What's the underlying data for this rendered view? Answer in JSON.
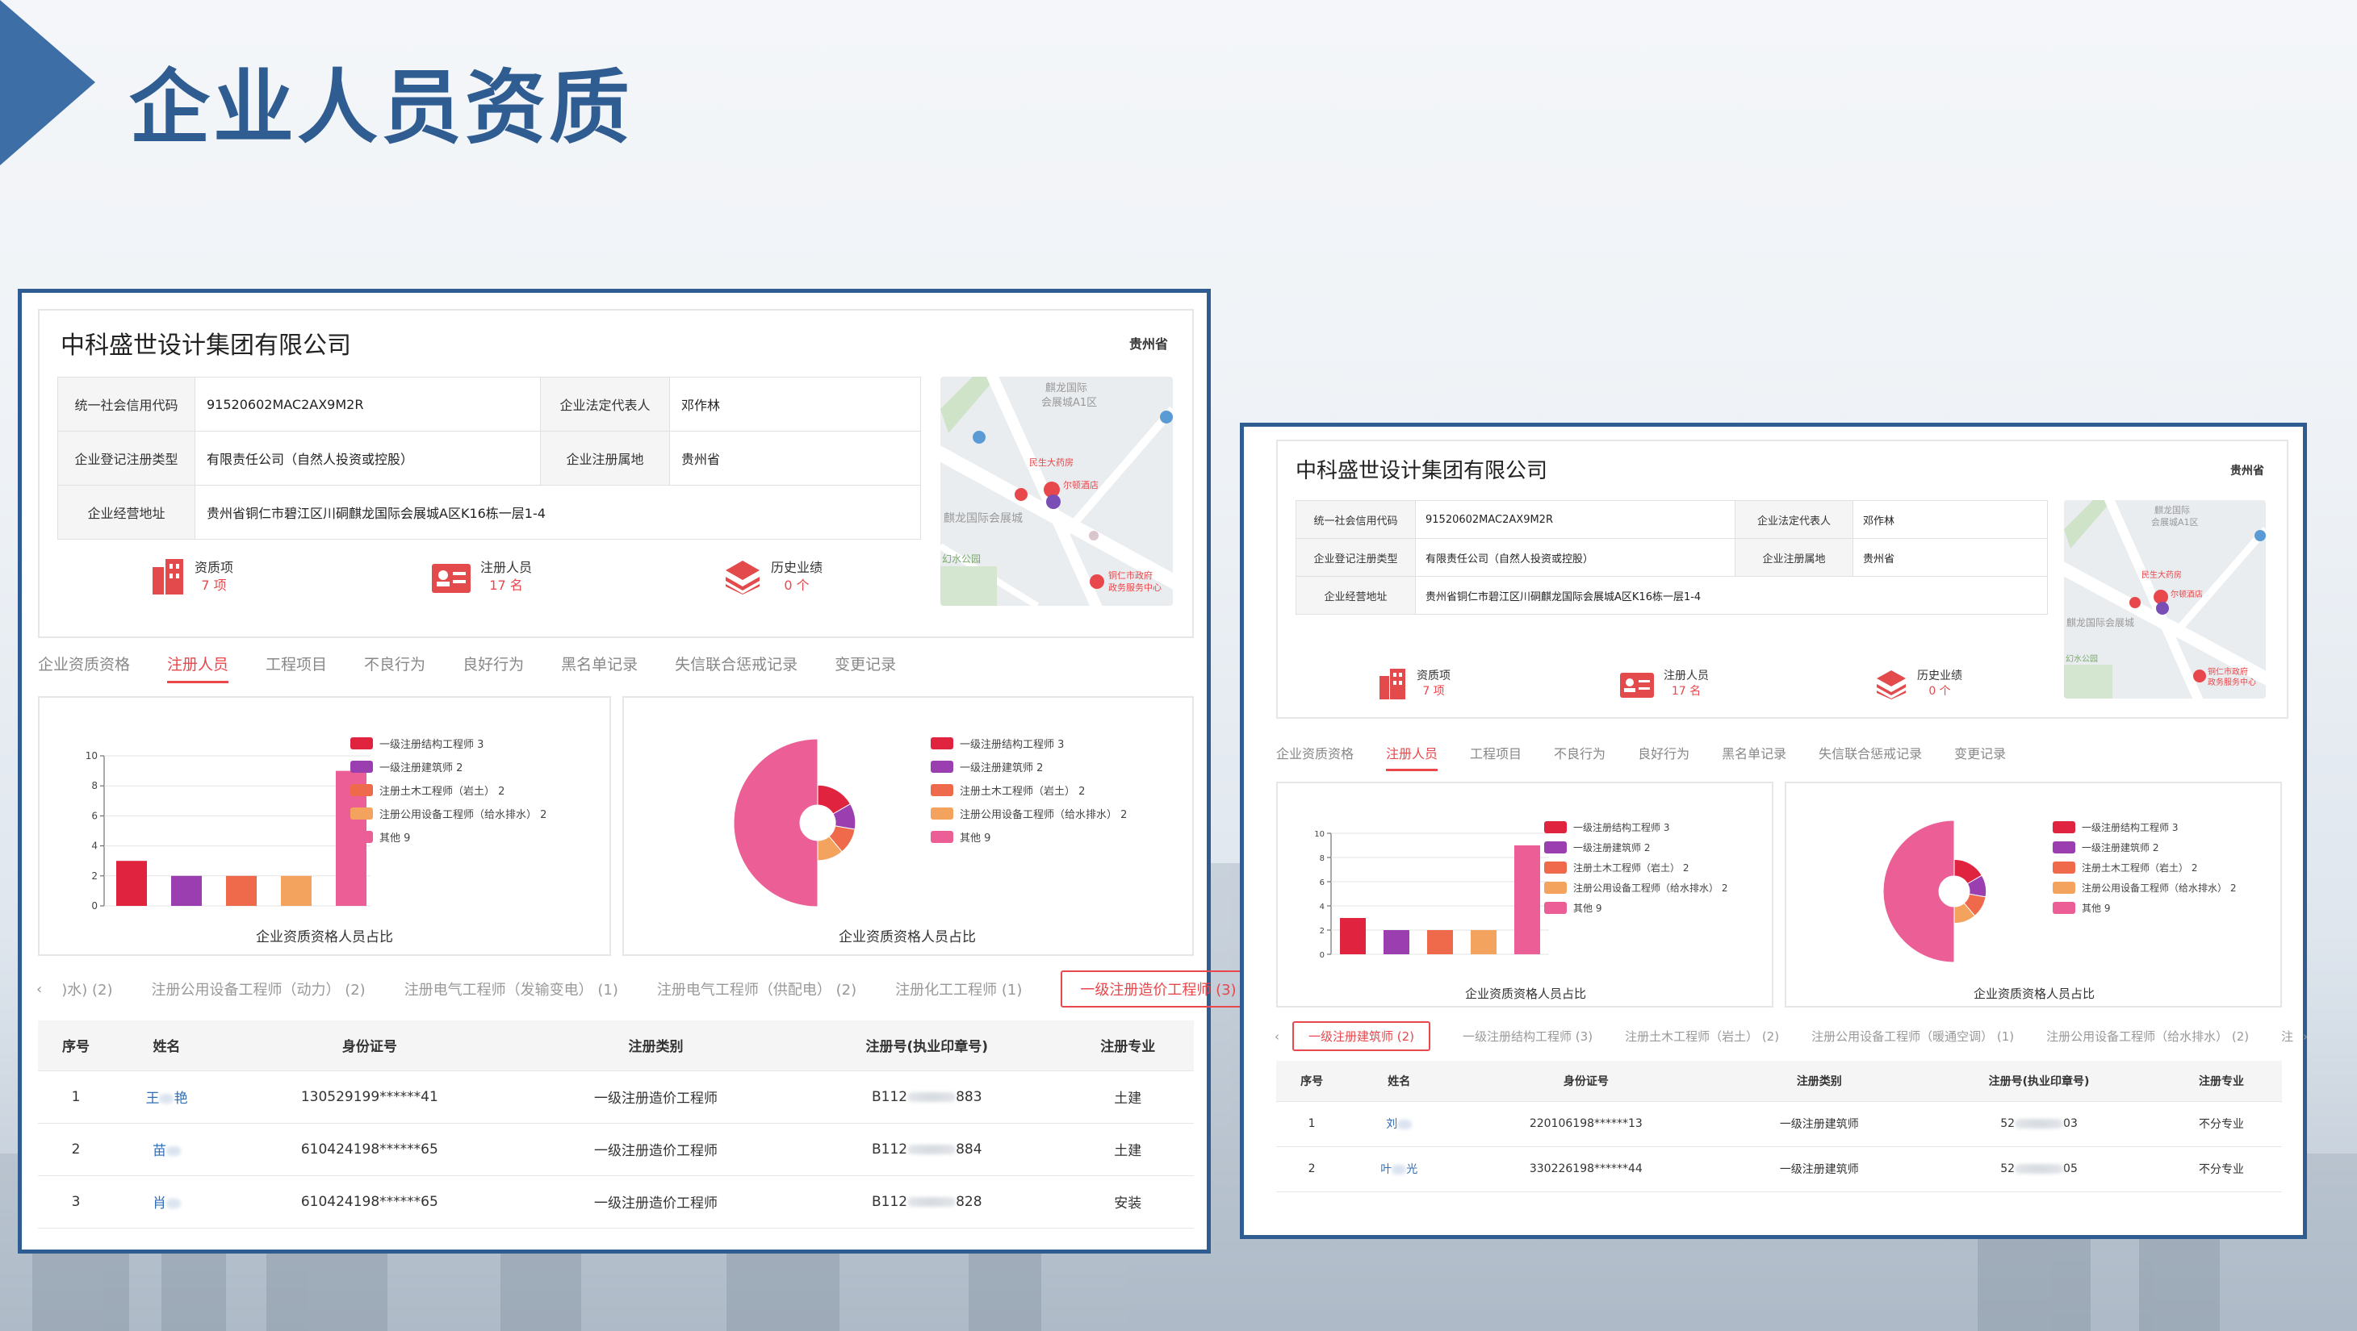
{
  "slide": {
    "title": "企业人员资质"
  },
  "company": {
    "name": "中科盛世设计集团有限公司",
    "province_badge": "贵州省",
    "info": [
      {
        "k1": "统一社会信用代码",
        "v1": "91520602MAC2AX9M2R",
        "k2": "企业法定代表人",
        "v2": "邓作林"
      },
      {
        "k1": "企业登记注册类型",
        "v1": "有限责任公司（自然人投资或控股）",
        "k2": "企业注册属地",
        "v2": "贵州省"
      },
      {
        "k1": "企业经营地址",
        "v1": "贵州省铜仁市碧江区川硐麒龙国际会展城A区K16栋一层1-4"
      }
    ],
    "map_labels": [
      "麒龙国际",
      "会展城A1区",
      "民生大药房",
      "尔顿酒店",
      "麒龙国际会展城",
      "幻水公园",
      "铜仁市政府",
      "政务服务中心"
    ],
    "stats": [
      {
        "label": "资质项",
        "value": "7 项",
        "icon": "building-icon"
      },
      {
        "label": "注册人员",
        "value": "17 名",
        "icon": "id-card-icon"
      },
      {
        "label": "历史业绩",
        "value": "0 个",
        "icon": "layers-icon"
      }
    ],
    "tabs": [
      "企业资质资格",
      "注册人员",
      "工程项目",
      "不良行为",
      "良好行为",
      "黑名单记录",
      "失信联合惩戒记录",
      "变更记录"
    ],
    "active_tab": "注册人员"
  },
  "chart_data": [
    {
      "type": "bar",
      "title": "企业资质资格人员占比",
      "categories": [
        "一级注册结构工程师",
        "一级注册建筑师",
        "注册土木工程师（岩土）",
        "注册公用设备工程师（给水排水）",
        "其他"
      ],
      "values": [
        3,
        2,
        2,
        2,
        9
      ],
      "legend": [
        "一级注册结构工程师 3",
        "一级注册建筑师 2",
        "注册土木工程师（岩土） 2",
        "注册公用设备工程师（给水排水） 2",
        "其他 9"
      ],
      "colors": [
        "#e0243f",
        "#9b3fb0",
        "#ef6a4b",
        "#f4a35f",
        "#ec5f96"
      ],
      "ylim": [
        0,
        10
      ],
      "yticks": [
        0,
        2,
        4,
        6,
        8,
        10
      ],
      "grid": true,
      "legend_position": "right"
    },
    {
      "type": "pie",
      "title": "企业资质资格人员占比",
      "categories": [
        "一级注册结构工程师",
        "一级注册建筑师",
        "注册土木工程师（岩土）",
        "注册公用设备工程师（给水排水）",
        "其他"
      ],
      "values": [
        3,
        2,
        2,
        2,
        9
      ],
      "legend": [
        "一级注册结构工程师 3",
        "一级注册建筑师 2",
        "注册土木工程师（岩土） 2",
        "注册公用设备工程师（给水排水） 2",
        "其他 9"
      ],
      "colors": [
        "#e0243f",
        "#9b3fb0",
        "#ef6a4b",
        "#f4a35f",
        "#ec5f96"
      ],
      "legend_position": "right"
    }
  ],
  "panel1": {
    "subtabs": [
      ")水)  (2)",
      "注册公用设备工程师（动力） (2)",
      "注册电气工程师（发输变电） (1)",
      "注册电气工程师（供配电） (2)",
      "注册化工工程师 (1)",
      "一级注册造价工程师 (3)"
    ],
    "active_subtab": "一级注册造价工程师 (3)",
    "headers": [
      "序号",
      "姓名",
      "身份证号",
      "注册类别",
      "注册号(执业印章号)",
      "注册专业"
    ],
    "rows": [
      {
        "no": "1",
        "name_a": "王",
        "name_b": "艳",
        "id": "130529199******41",
        "type": "一级注册造价工程师",
        "reg_a": "B112",
        "reg_b": "883",
        "major": "土建"
      },
      {
        "no": "2",
        "name_a": "苗",
        "name_b": "",
        "id": "610424198******65",
        "type": "一级注册造价工程师",
        "reg_a": "B112",
        "reg_b": "884",
        "major": "土建"
      },
      {
        "no": "3",
        "name_a": "肖",
        "name_b": "",
        "id": "610424198******65",
        "type": "一级注册造价工程师",
        "reg_a": "B112",
        "reg_b": "828",
        "major": "安装"
      }
    ]
  },
  "panel2": {
    "subtabs": [
      "一级注册建筑师 (2)",
      "一级注册结构工程师 (3)",
      "注册土木工程师（岩土） (2)",
      "注册公用设备工程师（暖通空调） (1)",
      "注册公用设备工程师（给水排水） (2)",
      "注"
    ],
    "active_subtab": "一级注册建筑师 (2)",
    "headers": [
      "序号",
      "姓名",
      "身份证号",
      "注册类别",
      "注册号(执业印章号)",
      "注册专业"
    ],
    "rows": [
      {
        "no": "1",
        "name_a": "刘",
        "name_b": "",
        "id": "220106198******13",
        "type": "一级注册建筑师",
        "reg_a": "52",
        "reg_b": "03",
        "major": "不分专业"
      },
      {
        "no": "2",
        "name_a": "叶",
        "name_b": "光",
        "id": "330226198******44",
        "type": "一级注册建筑师",
        "reg_a": "52",
        "reg_b": "05",
        "major": "不分专业"
      }
    ]
  },
  "nav": {
    "prev": "‹",
    "next": "›"
  }
}
